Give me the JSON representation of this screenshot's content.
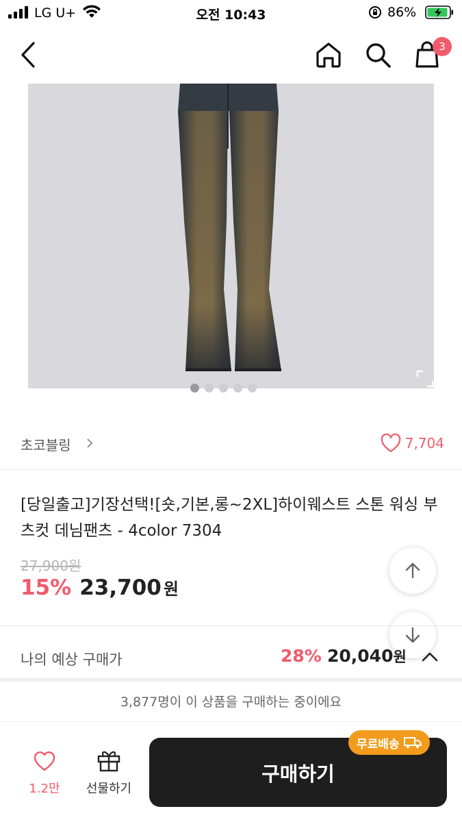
{
  "status_bar": {
    "carrier": "LG U+",
    "time": "오전 10:43",
    "battery": "86%"
  },
  "nav": {
    "back_icon": "chevron-left-icon",
    "home_icon": "home-icon",
    "search_icon": "search-icon",
    "cart_icon": "shopping-bag-icon",
    "cart_badge": "3"
  },
  "gallery": {
    "image_alt": "flared washed denim jeans",
    "dot_count": 5,
    "active_dot": 0
  },
  "brand": {
    "name": "초코블링",
    "like_count": "7,704"
  },
  "product": {
    "title": "[당일출고]기장선택![숏,기본,롱~2XL]하이웨스트 스톤 워싱 부츠컷 데님팬츠 - 4color 7304",
    "original_price": "27,900원",
    "discount": "15%",
    "sale_price": "23,700",
    "currency": "원"
  },
  "expected": {
    "label": "나의 예상 구매가",
    "discount": "28%",
    "price": "20,040",
    "currency": "원"
  },
  "buyers_notice": "3,877명이 이 상품을 구매하는 중이에요",
  "bottom_bar": {
    "wish_count": "1.2만",
    "gift_label": "선물하기",
    "buy_label": "구매하기",
    "free_shipping": "무료배송"
  },
  "colors": {
    "accent": "#f15b6c",
    "buy_button": "#1e1e1e",
    "free_shipping_badge": "#f29b1c"
  }
}
